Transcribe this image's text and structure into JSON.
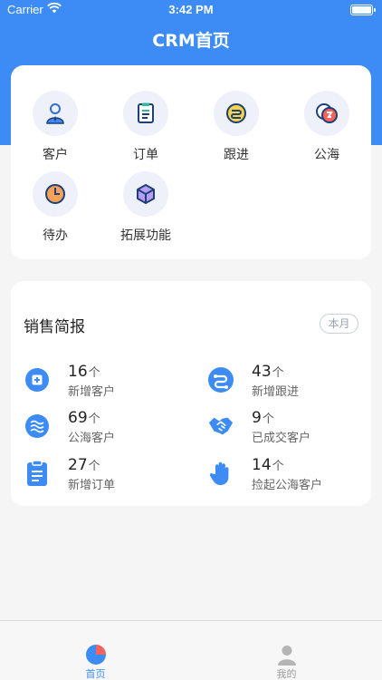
{
  "status_bar": {
    "carrier": "Carrier",
    "time": "3:42 PM"
  },
  "nav": {
    "title": "CRM首页"
  },
  "menu": {
    "items": [
      {
        "label": "客户",
        "icon": "customer-icon"
      },
      {
        "label": "订单",
        "icon": "order-icon"
      },
      {
        "label": "跟进",
        "icon": "follow-up-icon"
      },
      {
        "label": "公海",
        "icon": "public-pool-icon"
      },
      {
        "label": "待办",
        "icon": "todo-clock-icon"
      },
      {
        "label": "拓展功能",
        "icon": "extension-cube-icon"
      }
    ]
  },
  "report": {
    "title": "销售简报",
    "period": "本月",
    "stats": [
      {
        "value": "16",
        "unit": "个",
        "label": "新增客户",
        "icon": "add-customer-icon"
      },
      {
        "value": "43",
        "unit": "个",
        "label": "新增跟进",
        "icon": "follow-up-flow-icon"
      },
      {
        "value": "69",
        "unit": "个",
        "label": "公海客户",
        "icon": "waves-icon"
      },
      {
        "value": "9",
        "unit": "个",
        "label": "已成交客户",
        "icon": "handshake-icon"
      },
      {
        "value": "27",
        "unit": "个",
        "label": "新增订单",
        "icon": "clipboard-icon"
      },
      {
        "value": "14",
        "unit": "个",
        "label": "捡起公海客户",
        "icon": "hand-icon"
      }
    ]
  },
  "tabbar": {
    "tabs": [
      {
        "label": "首页",
        "icon": "pie-chart-icon",
        "active": true
      },
      {
        "label": "我的",
        "icon": "person-icon",
        "active": false
      }
    ]
  },
  "colors": {
    "brand": "#3d8cf6",
    "accent_orange": "#f5a15a",
    "accent_red": "#f4645a"
  }
}
